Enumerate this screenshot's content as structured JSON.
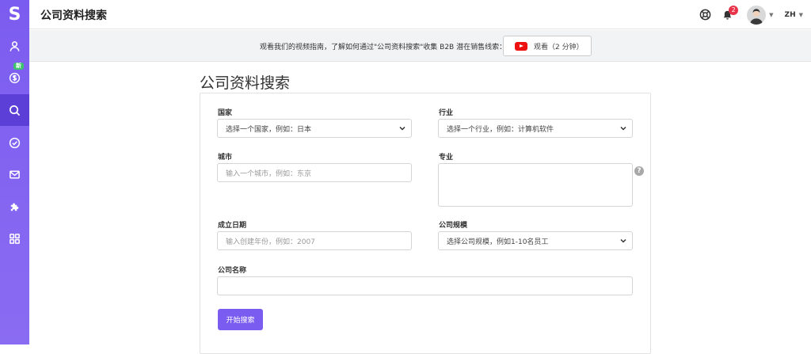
{
  "app": {
    "logo_letter": "S"
  },
  "header": {
    "title": "公司资料搜索",
    "notification_count": "2",
    "language": "ZH"
  },
  "sidebar": {
    "items": [
      {
        "icon": "user-icon"
      },
      {
        "icon": "coin-icon",
        "badge": "新"
      },
      {
        "icon": "search-icon",
        "active": true
      },
      {
        "icon": "check-circle-icon"
      },
      {
        "icon": "mail-icon"
      },
      {
        "icon": "puzzle-icon"
      },
      {
        "icon": "grid-icon"
      }
    ]
  },
  "banner": {
    "text": "观看我们的视频指南，了解如何通过\"公司资料搜索\"收集 B2B 潜在销售线索：",
    "video_button_label": "观看（2 分钟）"
  },
  "form": {
    "heading": "公司资料搜索",
    "country_label": "国家",
    "country_value": "选择一个国家，例如：日本",
    "industry_label": "行业",
    "industry_value": "选择一个行业，例如：计算机软件",
    "city_label": "城市",
    "city_placeholder": "输入一个城市，例如：东京",
    "specialty_label": "专业",
    "specialty_help": "?",
    "founded_label": "成立日期",
    "founded_placeholder": "输入创建年份，例如：2007",
    "size_label": "公司规模",
    "size_value": "选择公司规模，例如1-10名员工",
    "name_label": "公司名称",
    "name_placeholder": "",
    "submit_label": "开始搜索"
  }
}
